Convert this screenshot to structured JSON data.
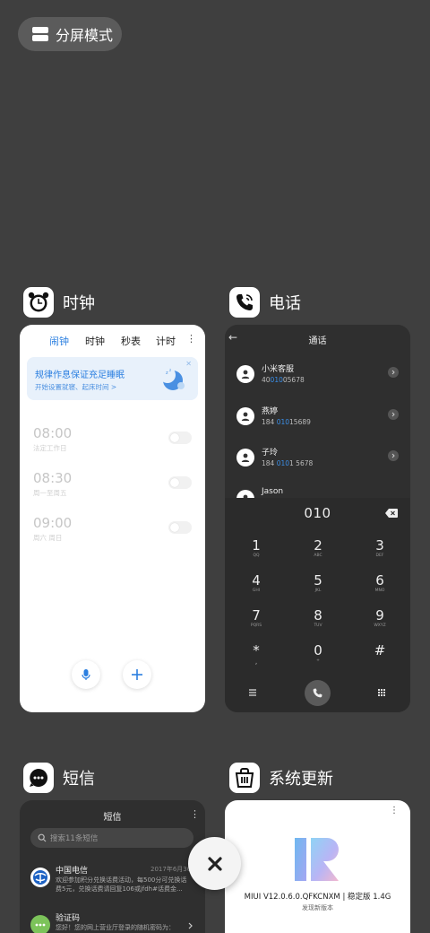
{
  "split_mode": {
    "label": "分屏模式"
  },
  "apps": {
    "clock": {
      "name": "时钟",
      "tabs": [
        "闹钟",
        "时钟",
        "秒表",
        "计时"
      ],
      "banner": {
        "title": "规律作息保证充足睡眠",
        "subtitle": "开始设置就寝、起床时间 >"
      },
      "alarms": [
        {
          "time": "08:00",
          "desc": "法定工作日"
        },
        {
          "time": "08:30",
          "desc": "周一至周五"
        },
        {
          "time": "09:00",
          "desc": "周六 周日"
        }
      ]
    },
    "phone": {
      "name": "电话",
      "title": "通话",
      "contacts": [
        {
          "name": "小米客服",
          "num_pre": "40",
          "num_hl": "010",
          "num_post": "05678"
        },
        {
          "name": "燕婷",
          "num_pre": "184 ",
          "num_hl": "010",
          "num_post": "15689"
        },
        {
          "name": "子玲",
          "num_pre": "184 ",
          "num_hl": "010",
          "num_post": "1 5678"
        },
        {
          "name": "Jason",
          "num_pre": "",
          "num_hl": "",
          "num_post": ""
        }
      ],
      "dialed": "010",
      "keys": [
        {
          "d": "1",
          "l": "QQ"
        },
        {
          "d": "2",
          "l": "ABC"
        },
        {
          "d": "3",
          "l": "DEF"
        },
        {
          "d": "4",
          "l": "GHI"
        },
        {
          "d": "5",
          "l": "JKL"
        },
        {
          "d": "6",
          "l": "MNO"
        },
        {
          "d": "7",
          "l": "PQRS"
        },
        {
          "d": "8",
          "l": "TUV"
        },
        {
          "d": "9",
          "l": "WXYZ"
        },
        {
          "d": "*",
          "l": ","
        },
        {
          "d": "0",
          "l": "+"
        },
        {
          "d": "#",
          "l": ""
        }
      ]
    },
    "sms": {
      "name": "短信",
      "title": "短信",
      "search_placeholder": "搜索11条短信",
      "messages": [
        {
          "sender": "中国电信",
          "date": "2017年6月30",
          "preview": "欢迎参加积分兑换话费活动，每500分可兑换话费5元，兑换话费请回复106或jfdh#话费金..."
        },
        {
          "sender": "验证码",
          "date": "",
          "preview": "您好！您的网上营业厅登录的随机密码为：710679，有效时间为3分钟"
        }
      ]
    },
    "update": {
      "name": "系统更新",
      "version": "MIUI V12.0.6.0.QFKCNXM | 稳定版 1.4G",
      "status": "发现新版本"
    }
  },
  "colors": {
    "background": "#3f3f3f",
    "accent": "#2b7fe0",
    "highlight": "#3b8fe8"
  }
}
